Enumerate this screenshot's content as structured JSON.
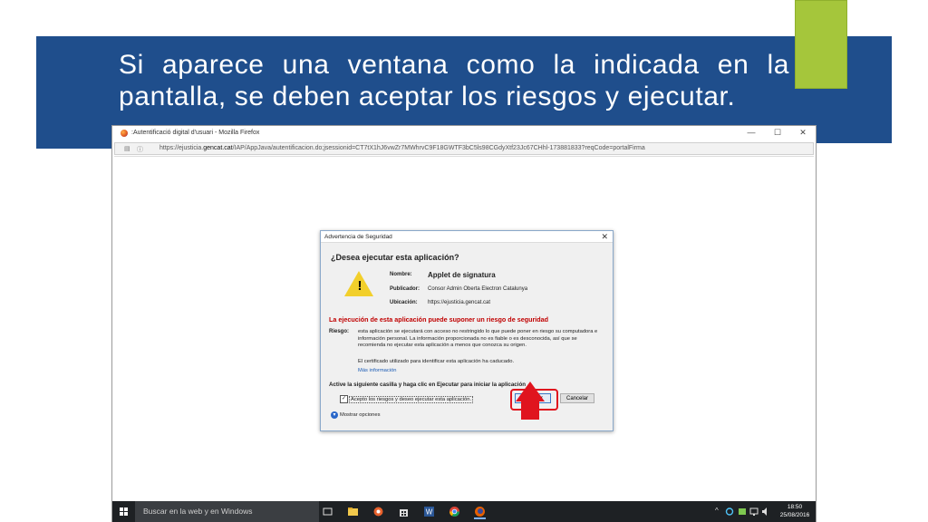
{
  "slide": {
    "title": "Si aparece una ventana como la indicada en la pantalla, se deben aceptar los riesgos y ejecutar."
  },
  "browser": {
    "window_title": ":Autentificació digital d'usuari - Mozilla Firefox",
    "url_prefix": "https://ejusticia.",
    "url_domain": "gencat.cat",
    "url_rest": "/IAP/AppJava/autentificacion.do;jsessionid=CT7tX1hJ6vwZr7MWhrvC9F18GWTF3bC5ls98CGdyXtf23Jc67CHhl-173881833?reqCode=portalFirma",
    "controls": {
      "minimize": "—",
      "maximize": "☐",
      "close": "✕"
    }
  },
  "dialog": {
    "title": "Advertencia de Seguridad",
    "close": "✕",
    "question": "¿Desea ejecutar esta aplicación?",
    "fields": [
      {
        "label": "Nombre:",
        "value": "Applet de signatura"
      },
      {
        "label": "Publicador:",
        "value": "Consor Admin Oberta Electron Catalunya"
      },
      {
        "label": "Ubicación:",
        "value": "https://ejusticia.gencat.cat"
      }
    ],
    "risk_title": "La ejecución de esta aplicación puede suponer un riesgo de seguridad",
    "risk_label": "Riesgo:",
    "risk_text": "esta aplicación se ejecutará con acceso no restringido lo que puede poner en riesgo su computadora e información personal. La información proporcionada no es fiable o es desconocida, así que se recomienda no ejecutar esta aplicación a menos que conozca su origen.",
    "cert_text": "El certificado utilizado para identificar esta aplicación ha caducado.",
    "more_info": "Más información",
    "instruction": "Active la siguiente casilla y haga clic en Ejecutar para iniciar la aplicación",
    "accept_label": "Acepto los riesgos y deseo ejecutar esta aplicación.",
    "accept_checked": true,
    "checkmark": "✓",
    "run_button": "Ejecutar",
    "cancel_button": "Cancelar",
    "show_options": "Mostrar opciones",
    "show_options_glyph": "▾"
  },
  "taskbar": {
    "search_placeholder": "Buscar en la web y en Windows",
    "tray_chevron": "^",
    "time": "18:50",
    "date": "25/08/2016"
  },
  "colors": {
    "slide_band": "#1f4e8c",
    "accent": "#a5c63b",
    "risk_red": "#c00000",
    "highlight_red": "#e0141e"
  }
}
